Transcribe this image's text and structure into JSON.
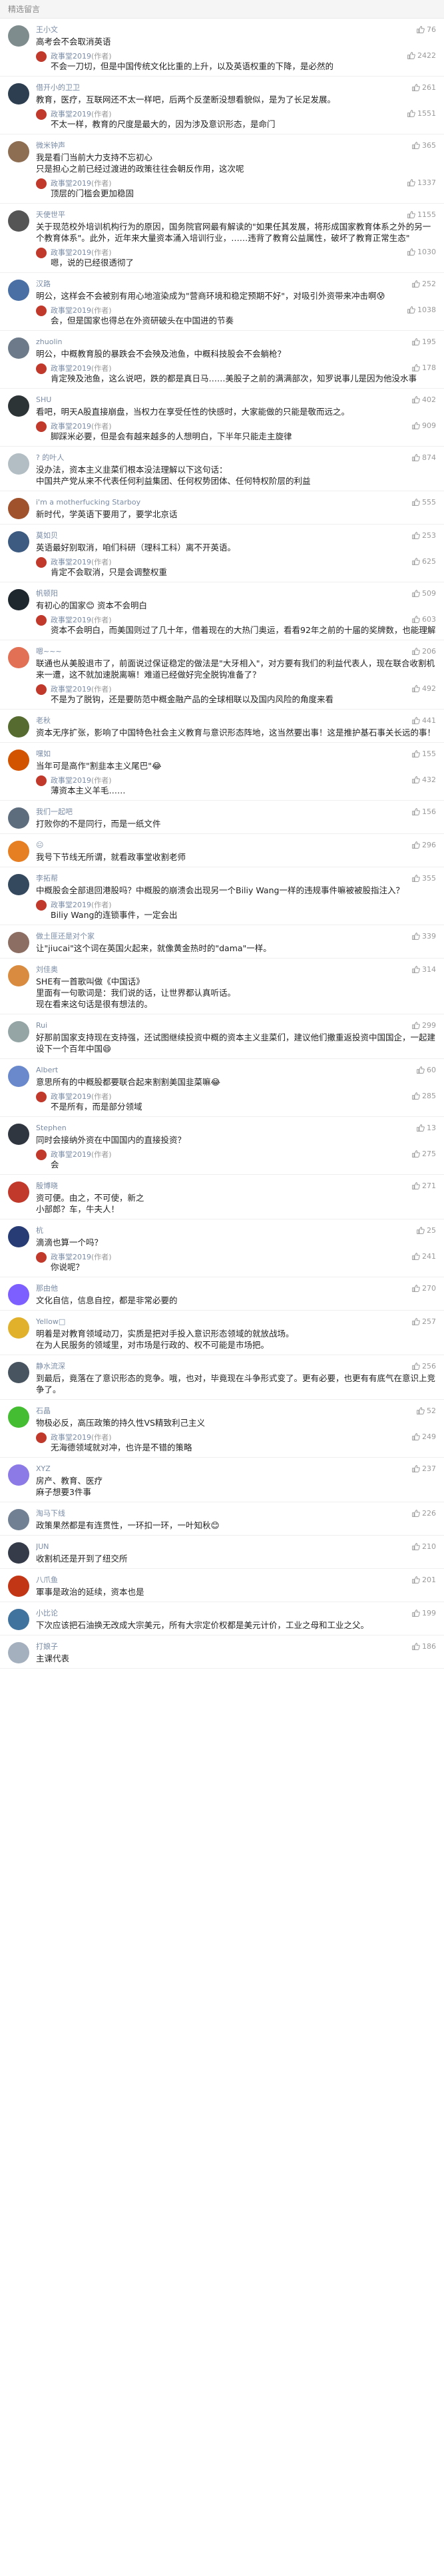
{
  "section_title": "精选留言",
  "comments": [
    {
      "user": "王小文",
      "text": "高考会不会取消英语",
      "likes": "76",
      "reply_user": "政事堂2019",
      "reply_tag": "(作者)",
      "reply_likes": "2422",
      "reply": "不会一刀切，但是中国传统文化比重的上升，以及英语权重的下降，是必然的"
    },
    {
      "user": "借开小的卫卫",
      "text": "教育，医疗，互联网还不太一样吧，后两个反垄断没想看貌似，是为了长足发展。",
      "likes": "261",
      "reply_user": "政事堂2019",
      "reply_tag": "(作者)",
      "reply_likes": "1551",
      "reply": "不太一样，教育的尺度是最大的，因为涉及意识形态，是命门"
    },
    {
      "user": "微米钟声",
      "text": "我是看门当前大力支持不忘初心\n只是担心之前已经过渡进的政策往往会朝反作用，这次呢",
      "likes": "365",
      "reply_user": "政事堂2019",
      "reply_tag": "(作者)",
      "reply_likes": "1337",
      "reply": "顶层的门槛会更加稳固"
    },
    {
      "user": "天使世平",
      "text": "关于现范校外培训机构行为的原因，国务院官网最有解读的\"如果任其发展，将形成国家教育体系之外的另一个教育体系\"。此外，近年来大量资本涌入培训行业，……违背了教育公益属性，破坏了教育正常生态\"",
      "likes": "1155",
      "reply_user": "政事堂2019",
      "reply_tag": "(作者)",
      "reply_likes": "1030",
      "reply": "嗯，说的已经很透彻了"
    },
    {
      "user": "汉路",
      "text": "明公，这样会不会被别有用心地渲染成为\"营商环境和稳定预期不好\"，对吸引外资带来冲击啊😰",
      "likes": "252",
      "reply_user": "政事堂2019",
      "reply_tag": "(作者)",
      "reply_likes": "1038",
      "reply": "会，但是国家也得总在外资研破头在中国进的节奏"
    },
    {
      "user": "zhuolin",
      "text": "明公，中概教育股的暴跌会不会殃及池鱼，中概科技股会不会躺枪？",
      "likes": "195",
      "reply_user": "政事堂2019",
      "reply_tag": "(作者)",
      "reply_likes": "178",
      "reply": "肯定殃及池鱼，这么说吧，跌的都是真日马……美股子之前的满满部次，知罗说事儿是因为他没水事"
    },
    {
      "user": "SHU",
      "text": "看吧，明天A股直接崩盘，当权力在享受任性的快感时，大家能做的只能是敬而远之。",
      "likes": "402",
      "reply_user": "政事堂2019",
      "reply_tag": "(作者)",
      "reply_likes": "909",
      "reply": "脚踩米必要，但是会有越来越多的人想明白，下半年只能走主旋律"
    },
    {
      "user": "? 的叶人",
      "text": "没办法，资本主义韭菜们根本没法理解以下这句话：\n中国共产党从来不代表任何利益集团、任何权势团体、任何特权阶层的利益",
      "likes": "874",
      "reply_user": "",
      "reply_tag": "",
      "reply_likes": "",
      "reply": ""
    },
    {
      "user": "i'm a motherfucking Starboy",
      "text": "新时代，学英语下要用了，要学北京话",
      "likes": "555",
      "reply_user": "",
      "reply_tag": "",
      "reply_likes": "",
      "reply": ""
    },
    {
      "user": "莫如贝",
      "text": "英语最好别取消，咱们科研（理科工科）离不开英语。",
      "likes": "253",
      "reply_user": "政事堂2019",
      "reply_tag": "(作者)",
      "reply_likes": "625",
      "reply": "肯定不会取消，只是会调整权重"
    },
    {
      "user": "帆顿阳",
      "text": "有初心的国家😊 资本不会明白",
      "likes": "509",
      "reply_user": "政事堂2019",
      "reply_tag": "(作者)",
      "reply_likes": "603",
      "reply": "资本不会明白，而美国则过了几十年，借着现在的大热门奥运，看看92年之前的十届的奖牌数，也能理解"
    },
    {
      "user": "嗯~~~",
      "text": "联通也从美股退市了，前面说过保证稳定的做法是\"大牙相入\"，对方要有我们的利益代表人，现在联合收割机来一遭，这不就加速脱离嘛！难道已经做好完全脱钩准备了？",
      "likes": "206",
      "reply_user": "政事堂2019",
      "reply_tag": "(作者)",
      "reply_likes": "492",
      "reply": "不是为了脱钩，还是要防范中概金融产品的全球相联以及国内风险的角度来看"
    },
    {
      "user": "老秋",
      "text": "资本无序扩张，影响了中国特色社会主义教育与意识形态阵地，这当然要出事！这是推护基石事关长远的事！",
      "likes": "441",
      "reply_user": "",
      "reply_tag": "",
      "reply_likes": "",
      "reply": ""
    },
    {
      "user": "嘿如",
      "text": "当年可是高作\"割韭本主义尾巴\"😂",
      "likes": "155",
      "reply_user": "政事堂2019",
      "reply_tag": "(作者)",
      "reply_likes": "432",
      "reply": "薄资本主义羊毛……"
    },
    {
      "user": "我们一起吧",
      "text": "打败你的不是同行，而是一纸文件",
      "likes": "156",
      "reply_user": "",
      "reply_tag": "",
      "reply_likes": "",
      "reply": ""
    },
    {
      "user": "😐",
      "text": "我号下节线无所谓，就看政事堂收割老师",
      "likes": "296",
      "reply_user": "",
      "reply_tag": "",
      "reply_likes": "",
      "reply": ""
    },
    {
      "user": "李拓帮",
      "text": "中概股会全部退回港股吗？中概股的崩溃会出现另一个Biliy Wang一样的违规事件嘛被被股指注入？",
      "likes": "355",
      "reply_user": "政事堂2019",
      "reply_tag": "(作者)",
      "reply_likes": "",
      "reply": "Biliy Wang的连锁事件，一定会出"
    },
    {
      "user": "做土匪还是对个家",
      "text": "让\"jiucai\"这个词在英国火起来，就像黄金热时的\"dama\"一样。",
      "likes": "339",
      "reply_user": "",
      "reply_tag": "",
      "reply_likes": "",
      "reply": ""
    },
    {
      "user": "刘佳奥",
      "text": "SHE有一首歌叫做《中国话》\n里面有一句歌词是：我们说的话，让世界都认真听话。\n现在看来这句话是很有想法的。",
      "likes": "314",
      "reply_user": "",
      "reply_tag": "",
      "reply_likes": "",
      "reply": ""
    },
    {
      "user": "Rui",
      "text": "好那前国家支持现在支持强，还试图继续投资中概的资本主义韭菜们，建议他们撒重返投资中国国企，一起建设下一个百年中国😄",
      "likes": "299",
      "reply_user": "",
      "reply_tag": "",
      "reply_likes": "",
      "reply": ""
    },
    {
      "user": "Albert",
      "text": "意思所有的中概股都要联合起来割割美国韭菜嘛😂",
      "likes": "60",
      "reply_user": "政事堂2019",
      "reply_tag": "(作者)",
      "reply_likes": "285",
      "reply": "不是所有，而是部分领域"
    },
    {
      "user": "Stephen",
      "text": "同时会接纳外资在中国国内的直接投资？",
      "likes": "13",
      "reply_user": "政事堂2019",
      "reply_tag": "(作者)",
      "reply_likes": "275",
      "reply": "会"
    },
    {
      "user": "殷博晓",
      "text": "资可便。由之，不可使，新之\n小部郎？车，牛夫人！",
      "likes": "271",
      "reply_user": "",
      "reply_tag": "",
      "reply_likes": "",
      "reply": ""
    },
    {
      "user": "杭",
      "text": "滴滴也算一个吗？",
      "likes": "25",
      "reply_user": "政事堂2019",
      "reply_tag": "(作者)",
      "reply_likes": "241",
      "reply": "你说呢？"
    },
    {
      "user": "那由他",
      "text": "文化自信，信息自控，都是非常必要的",
      "likes": "270",
      "reply_user": "",
      "reply_tag": "",
      "reply_likes": "",
      "reply": ""
    },
    {
      "user": "Yellow□",
      "text": "明着是对教育领域动刀，实质是把对手投入意识形态领域的就放战场。\n在为人民服务的领域里，对市场是行政的、权不可能是市场把。",
      "likes": "257",
      "reply_user": "",
      "reply_tag": "",
      "reply_likes": "",
      "reply": ""
    },
    {
      "user": "静水流深",
      "text": "到最后，竟落在了意识形态的竞争。哦，也对，毕竟现在斗争形式变了。更有必要，也更有有底气在意识上竞争了。",
      "likes": "256",
      "reply_user": "",
      "reply_tag": "",
      "reply_likes": "",
      "reply": ""
    },
    {
      "user": "石晶",
      "text": "物极必反，高压政策的持久性VS精致利己主义",
      "likes": "52",
      "reply_user": "政事堂2019",
      "reply_tag": "(作者)",
      "reply_likes": "249",
      "reply": "无海德领域就对冲，也许是不错的策略"
    },
    {
      "user": "XYZ",
      "text": "房产、教育、医疗\n麻子想要3件事",
      "likes": "237",
      "reply_user": "",
      "reply_tag": "",
      "reply_likes": "",
      "reply": ""
    },
    {
      "user": "淘马下线",
      "text": "政策果然都是有连贯性，一环扣一环，一叶知秋😊",
      "likes": "226",
      "reply_user": "",
      "reply_tag": "",
      "reply_likes": "",
      "reply": ""
    },
    {
      "user": "JUN",
      "text": "收割机还是开到了纽交所",
      "likes": "210",
      "reply_user": "",
      "reply_tag": "",
      "reply_likes": "",
      "reply": ""
    },
    {
      "user": "八爪鱼",
      "text": "軍事是政治的延续，资本也是",
      "likes": "201",
      "reply_user": "",
      "reply_tag": "",
      "reply_likes": "",
      "reply": ""
    },
    {
      "user": "小比论",
      "text": "下次应该把石油换无改成大宗美元，所有大宗定价权都是美元计价，工业之母和工业之父。",
      "likes": "199",
      "reply_user": "",
      "reply_tag": "",
      "reply_likes": "",
      "reply": ""
    },
    {
      "user": "打娘子",
      "text": "主课代表",
      "likes": "186",
      "reply_user": "",
      "reply_tag": "",
      "reply_likes": "",
      "reply": ""
    }
  ],
  "avatar_colors": [
    "#7f8c8d",
    "#2c3e50",
    "#8e6e53",
    "#555555",
    "#4a6fa5",
    "#6c7a89",
    "#2d3436",
    "#b2bec3",
    "#a0522d",
    "#3d5a80",
    "#1e272e",
    "#e17055",
    "#556b2f",
    "#d35400",
    "#5d6d7e",
    "#e67e22",
    "#34495e",
    "#8d6e63",
    "#d98c3f",
    "#95a5a6",
    "#6a89cc",
    "#2f3640",
    "#c0392b",
    "#273c75",
    "#7d5fff",
    "#e1b12c",
    "#485460",
    "#44bd32",
    "#8c7ae6",
    "#718093",
    "#353b48",
    "#c23616",
    "#40739e",
    "#a4b0be"
  ]
}
